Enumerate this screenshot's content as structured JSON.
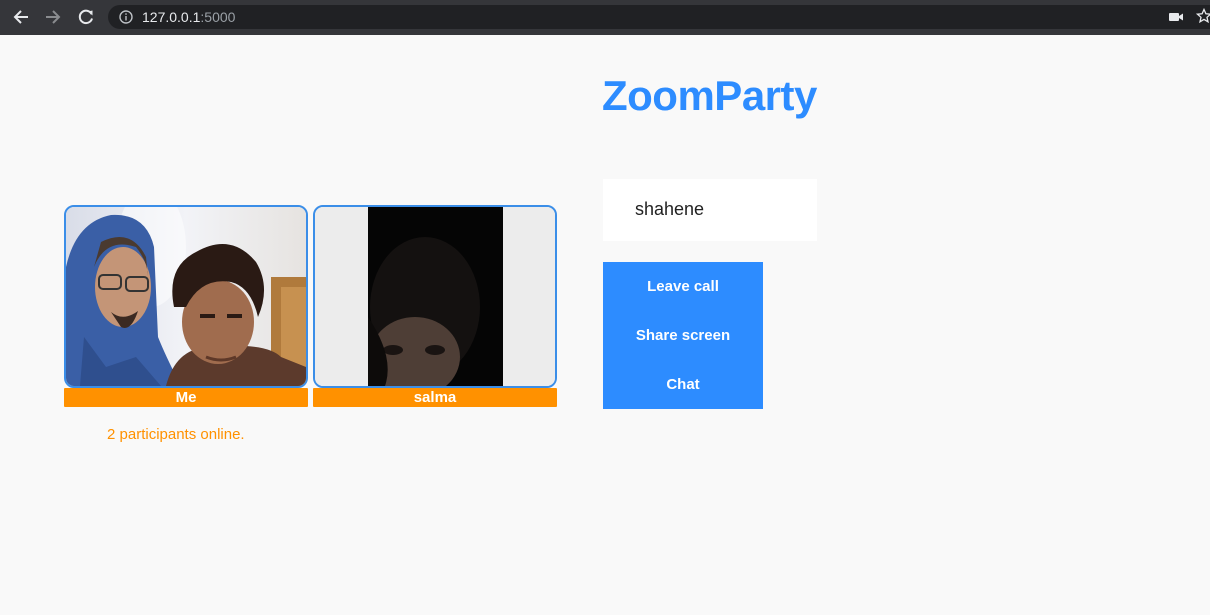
{
  "browser": {
    "url_host": "127.0.0.1",
    "url_port": ":5000",
    "icons": [
      "back-arrow-icon",
      "forward-arrow-icon",
      "reload-icon",
      "info-icon",
      "camera-icon",
      "star-icon"
    ]
  },
  "app": {
    "title": "ZoomParty",
    "accent_color": "#2d8cff",
    "tag_color": "#ff9100"
  },
  "participants": [
    {
      "name": "Me"
    },
    {
      "name": "salma"
    }
  ],
  "participants_status": "2 participants online.",
  "user": {
    "name": "shahene"
  },
  "controls": {
    "leave_label": "Leave call",
    "share_label": "Share screen",
    "chat_label": "Chat"
  }
}
